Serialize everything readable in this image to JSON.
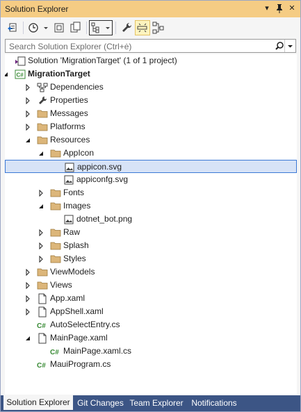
{
  "window": {
    "title": "Solution Explorer"
  },
  "titlebar": {
    "dropdown_icon": "▾",
    "pin_icon": "📌",
    "close_icon": "✕"
  },
  "search": {
    "placeholder": "Search Solution Explorer (Ctrl+ė)"
  },
  "tree": [
    {
      "label": "Solution 'MigrationTarget' (1 of 1 project)",
      "icon": "solution-icon",
      "level": 0,
      "expander": "none",
      "bold": false
    },
    {
      "label": "MigrationTarget",
      "icon": "csharp-project-icon",
      "level": 0,
      "expander": "expanded",
      "bold": true
    },
    {
      "label": "Dependencies",
      "icon": "dependencies-icon",
      "level": 1,
      "expander": "collapsed",
      "bold": false
    },
    {
      "label": "Properties",
      "icon": "properties-icon",
      "level": 1,
      "expander": "collapsed",
      "bold": false
    },
    {
      "label": "Messages",
      "icon": "folder-icon",
      "level": 1,
      "expander": "collapsed",
      "bold": false
    },
    {
      "label": "Platforms",
      "icon": "folder-icon",
      "level": 1,
      "expander": "collapsed",
      "bold": false
    },
    {
      "label": "Resources",
      "icon": "folder-icon",
      "level": 1,
      "expander": "expanded",
      "bold": false
    },
    {
      "label": "AppIcon",
      "icon": "folder-icon",
      "level": 2,
      "expander": "expanded",
      "bold": false
    },
    {
      "label": "appicon.svg",
      "icon": "image-file-icon",
      "level": 3,
      "expander": "none",
      "bold": false,
      "selected": true
    },
    {
      "label": "appiconfg.svg",
      "icon": "image-file-icon",
      "level": 3,
      "expander": "none",
      "bold": false
    },
    {
      "label": "Fonts",
      "icon": "folder-icon",
      "level": 2,
      "expander": "collapsed",
      "bold": false
    },
    {
      "label": "Images",
      "icon": "folder-icon",
      "level": 2,
      "expander": "expanded",
      "bold": false
    },
    {
      "label": "dotnet_bot.png",
      "icon": "image-file-icon",
      "level": 3,
      "expander": "none",
      "bold": false
    },
    {
      "label": "Raw",
      "icon": "folder-icon",
      "level": 2,
      "expander": "collapsed",
      "bold": false
    },
    {
      "label": "Splash",
      "icon": "folder-icon",
      "level": 2,
      "expander": "collapsed",
      "bold": false
    },
    {
      "label": "Styles",
      "icon": "folder-icon",
      "level": 2,
      "expander": "collapsed",
      "bold": false
    },
    {
      "label": "ViewModels",
      "icon": "folder-icon",
      "level": 1,
      "expander": "collapsed",
      "bold": false
    },
    {
      "label": "Views",
      "icon": "folder-icon",
      "level": 1,
      "expander": "collapsed",
      "bold": false
    },
    {
      "label": "App.xaml",
      "icon": "xaml-file-icon",
      "level": 1,
      "expander": "collapsed",
      "bold": false
    },
    {
      "label": "AppShell.xaml",
      "icon": "xaml-file-icon",
      "level": 1,
      "expander": "collapsed",
      "bold": false
    },
    {
      "label": "AutoSelectEntry.cs",
      "icon": "csharp-file-icon",
      "level": 1,
      "expander": "none",
      "bold": false
    },
    {
      "label": "MainPage.xaml",
      "icon": "xaml-file-icon",
      "level": 1,
      "expander": "expanded",
      "bold": false
    },
    {
      "label": "MainPage.xaml.cs",
      "icon": "csharp-file-icon",
      "level": 2,
      "expander": "none",
      "bold": false
    },
    {
      "label": "MauiProgram.cs",
      "icon": "csharp-file-icon",
      "level": 1,
      "expander": "none",
      "bold": false
    }
  ],
  "tabs": [
    {
      "label": "Solution Explorer",
      "active": true
    },
    {
      "label": "Git Changes",
      "active": false
    },
    {
      "label": "Team Explorer",
      "active": false
    },
    {
      "label": "Notifications",
      "active": false
    }
  ],
  "colors": {
    "title_bar": "#f5cc84",
    "selection": "#d7e3f7",
    "selection_border": "#3b78d6",
    "tab_strip": "#3c5585",
    "folder": "#dcb67a",
    "csharp": "#388a34"
  }
}
